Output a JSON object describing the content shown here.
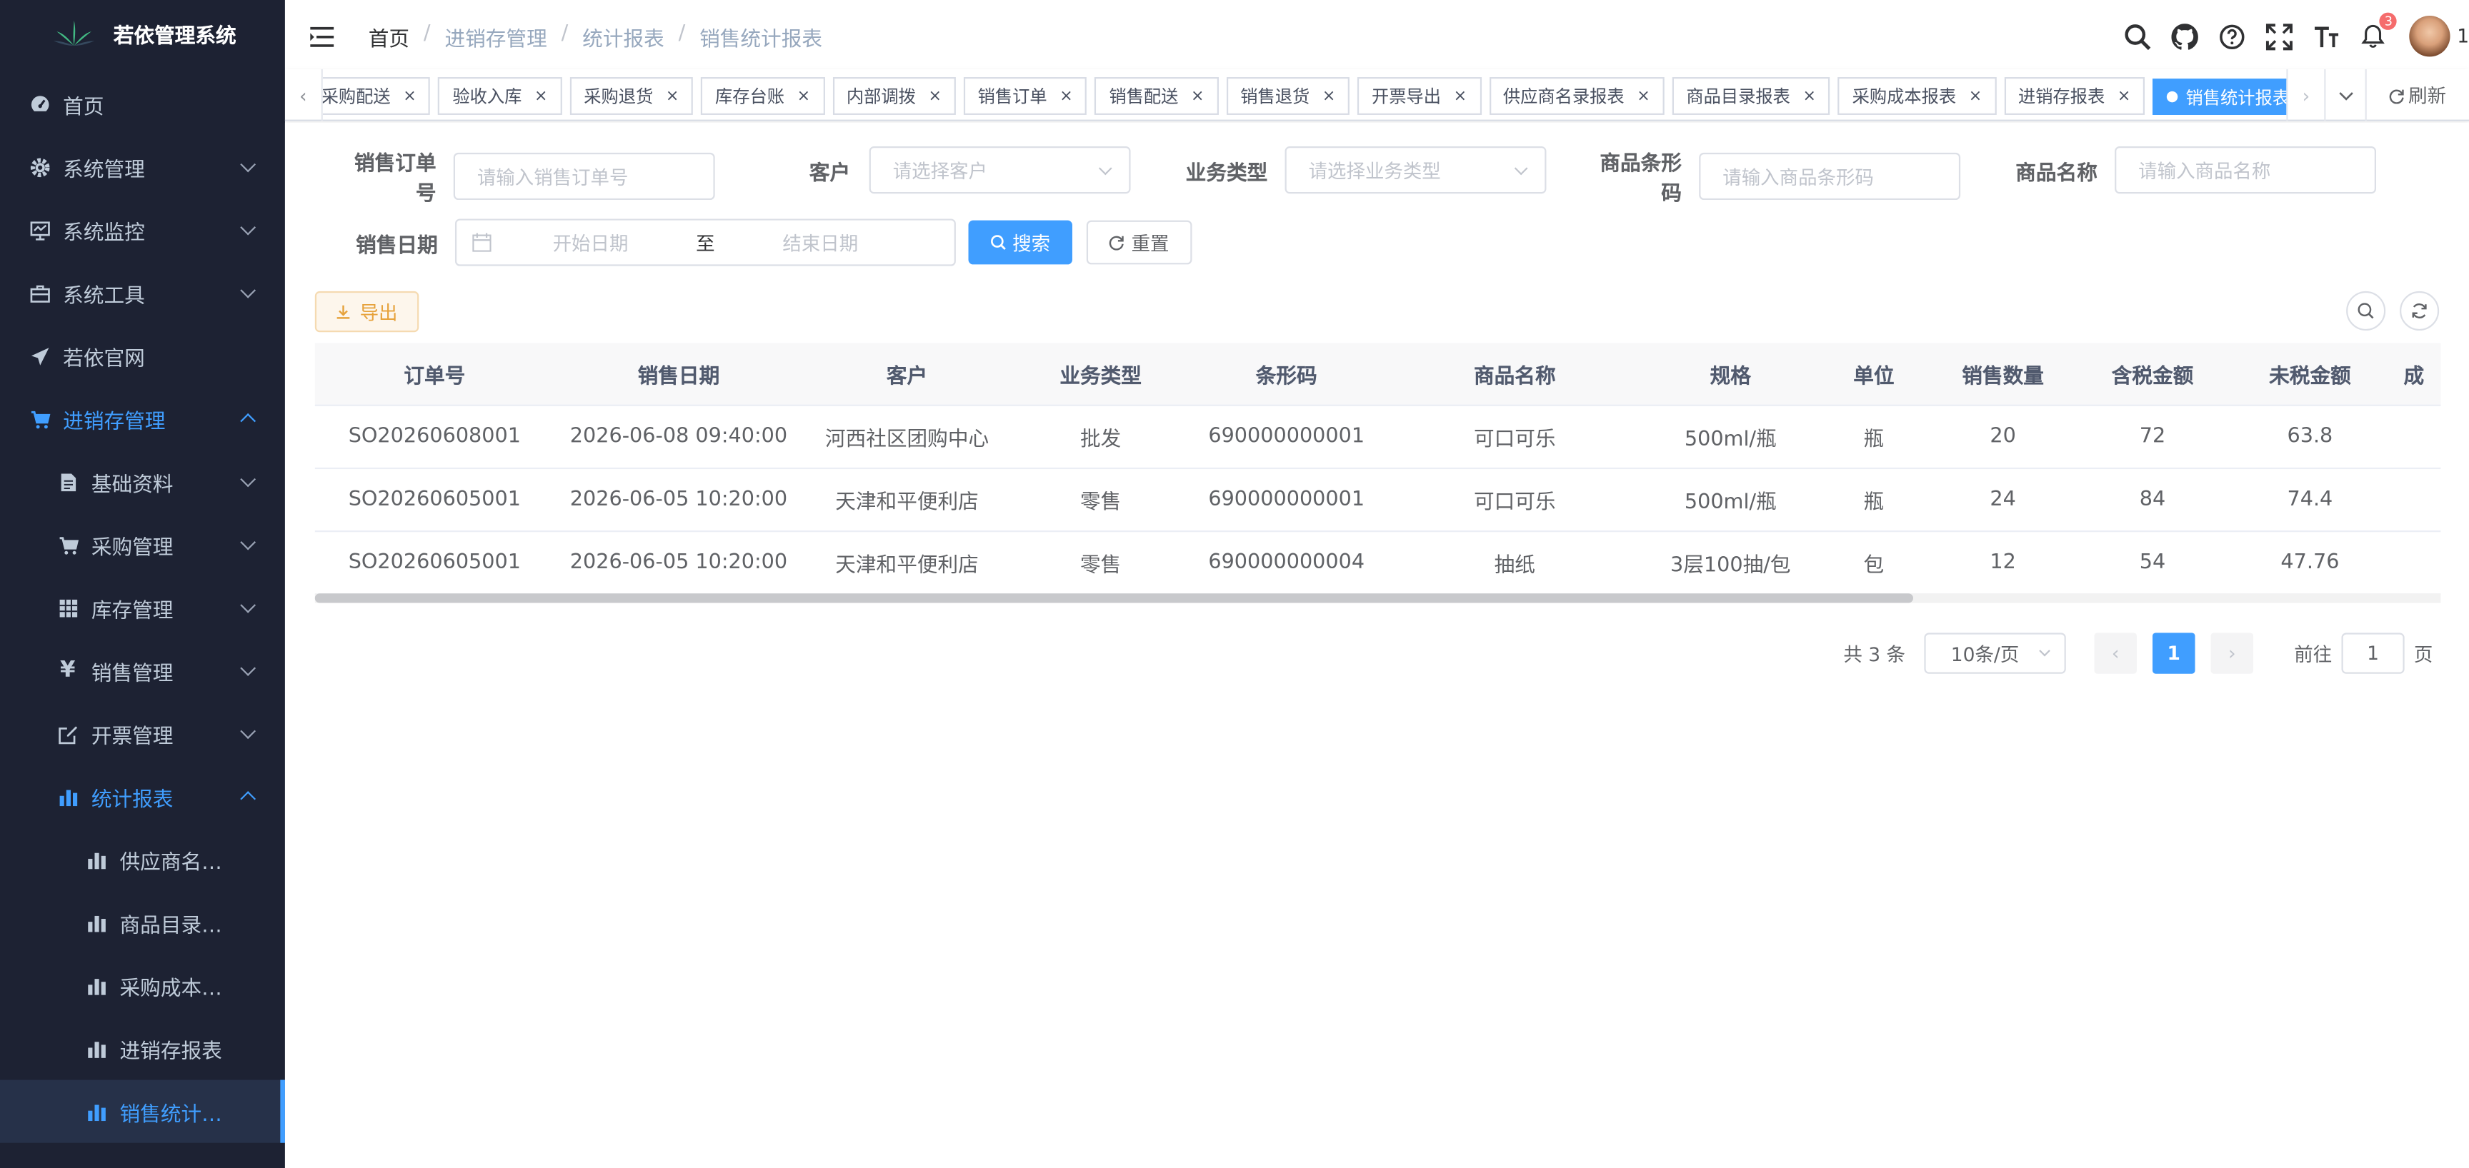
{
  "app": {
    "title": "若依管理系统"
  },
  "sidebar": {
    "items": [
      {
        "label": "首页",
        "icon": "dashboard-icon"
      },
      {
        "label": "系统管理",
        "icon": "gear-icon"
      },
      {
        "label": "系统监控",
        "icon": "monitor-icon"
      },
      {
        "label": "系统工具",
        "icon": "toolbox-icon"
      },
      {
        "label": "若依官网",
        "icon": "paper-plane-icon"
      },
      {
        "label": "进销存管理",
        "icon": "cart-icon"
      },
      {
        "label": "基础资料",
        "icon": "document-icon"
      },
      {
        "label": "采购管理",
        "icon": "cart-icon"
      },
      {
        "label": "库存管理",
        "icon": "grid-icon"
      },
      {
        "label": "销售管理",
        "icon": "yen-icon"
      },
      {
        "label": "开票管理",
        "icon": "edit-icon"
      },
      {
        "label": "统计报表",
        "icon": "bar-chart-icon"
      },
      {
        "label": "供应商名…",
        "icon": "bar-chart-icon"
      },
      {
        "label": "商品目录…",
        "icon": "bar-chart-icon"
      },
      {
        "label": "采购成本…",
        "icon": "bar-chart-icon"
      },
      {
        "label": "进销存报表",
        "icon": "bar-chart-icon"
      },
      {
        "label": "销售统计…",
        "icon": "bar-chart-icon"
      }
    ]
  },
  "header": {
    "breadcrumb": [
      "首页",
      "进销存管理",
      "统计报表",
      "销售统计报表"
    ],
    "notification_count": "3",
    "user_label": "1"
  },
  "tags": {
    "items": [
      "采购配送",
      "验收入库",
      "采购退货",
      "库存台账",
      "内部调拨",
      "销售订单",
      "销售配送",
      "销售退货",
      "开票导出",
      "供应商名录报表",
      "商品目录报表",
      "采购成本报表",
      "进销存报表",
      "销售统计报表"
    ],
    "refresh_label": "刷新"
  },
  "search": {
    "order_no_label": "销售订单号",
    "order_no_placeholder": "请输入销售订单号",
    "customer_label": "客户",
    "customer_placeholder": "请选择客户",
    "biz_type_label": "业务类型",
    "biz_type_placeholder": "请选择业务类型",
    "barcode_label": "商品条形码",
    "barcode_placeholder": "请输入商品条形码",
    "product_name_label": "商品名称",
    "product_name_placeholder": "请输入商品名称",
    "date_label": "销售日期",
    "start_placeholder": "开始日期",
    "range_sep": "至",
    "end_placeholder": "结束日期",
    "search_btn": "搜索",
    "reset_btn": "重置"
  },
  "toolbar": {
    "export_label": "导出"
  },
  "table": {
    "columns": [
      "订单号",
      "销售日期",
      "客户",
      "业务类型",
      "条形码",
      "商品名称",
      "规格",
      "单位",
      "销售数量",
      "含税金额",
      "未税金额",
      "成"
    ],
    "rows": [
      [
        "SO20260608001",
        "2026-06-08 09:40:00",
        "河西社区团购中心",
        "批发",
        "690000000001",
        "可口可乐",
        "500ml/瓶",
        "瓶",
        "20",
        "72",
        "63.8",
        ""
      ],
      [
        "SO20260605001",
        "2026-06-05 10:20:00",
        "天津和平便利店",
        "零售",
        "690000000001",
        "可口可乐",
        "500ml/瓶",
        "瓶",
        "24",
        "84",
        "74.4",
        ""
      ],
      [
        "SO20260605001",
        "2026-06-05 10:20:00",
        "天津和平便利店",
        "零售",
        "690000000004",
        "抽纸",
        "3层100抽/包",
        "包",
        "12",
        "54",
        "47.76",
        ""
      ]
    ]
  },
  "pagination": {
    "total_text": "共 3 条",
    "page_size": "10条/页",
    "current_page": "1",
    "goto_label": "前往",
    "goto_value": "1",
    "page_unit": "页"
  },
  "colors": {
    "primary": "#409eff",
    "sidebar_bg": "#1d2233",
    "warning": "#e6a23c"
  }
}
